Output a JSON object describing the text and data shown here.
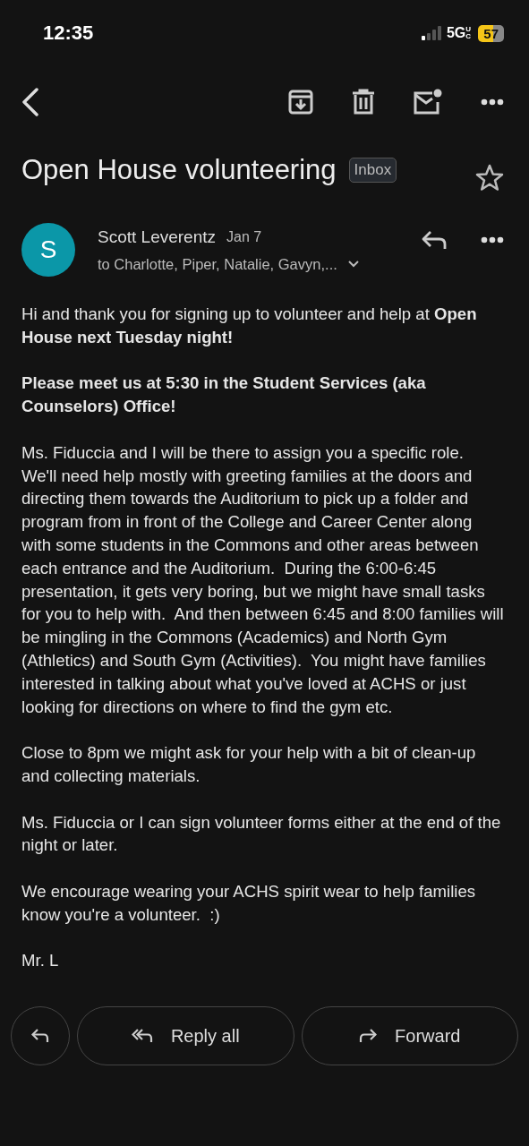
{
  "status_bar": {
    "time": "12:35",
    "network": "5G",
    "network_sub": "UC",
    "battery": "57"
  },
  "subject": "Open House volunteering",
  "label": "Inbox",
  "starred": false,
  "message": {
    "avatar": "S",
    "sender": "Scott Leverentz",
    "date": "Jan 7",
    "recipients": "to Charlotte, Piper, Natalie, Gavyn,...",
    "paragraphs": [
      {
        "text": "Hi and thank you for signing up to volunteer and help at **Open House next Tuesday night!**",
        "bold": false
      },
      {
        "text": "Please meet us at 5:30 in the Student Services (aka Counselors) Office!",
        "bold": true
      },
      {
        "text": "Ms. Fiduccia and I will be there to assign you a specific role.  We'll need help mostly with greeting families at the doors and directing them towards the Auditorium to pick up a folder and program from in front of the College and Career Center along with some students in the Commons and other areas between each entrance and the Auditorium.  During the 6:00-6:45 presentation, it gets very boring, but we might have small tasks for you to help with.  And then between 6:45 and 8:00 families will be mingling in the Commons (Academics) and North Gym (Athletics) and South Gym (Activities).  You might have families interested in talking about what you've loved at ACHS or just looking for directions on where to find the gym etc.",
        "bold": false
      },
      {
        "text": "Close to 8pm we might ask for your help with a bit of clean-up and collecting materials.",
        "bold": false
      },
      {
        "text": "Ms. Fiduccia or I can sign volunteer forms either at the end of the night or later.",
        "bold": false
      },
      {
        "text": "We encourage wearing your ACHS spirit wear to help families know you're a volunteer.  :)",
        "bold": false
      },
      {
        "text": "Mr. L",
        "bold": false
      }
    ]
  },
  "actions": [
    {
      "label": "Reply all",
      "kind": "reply_all"
    },
    {
      "label": "Forward",
      "kind": "forward"
    }
  ]
}
